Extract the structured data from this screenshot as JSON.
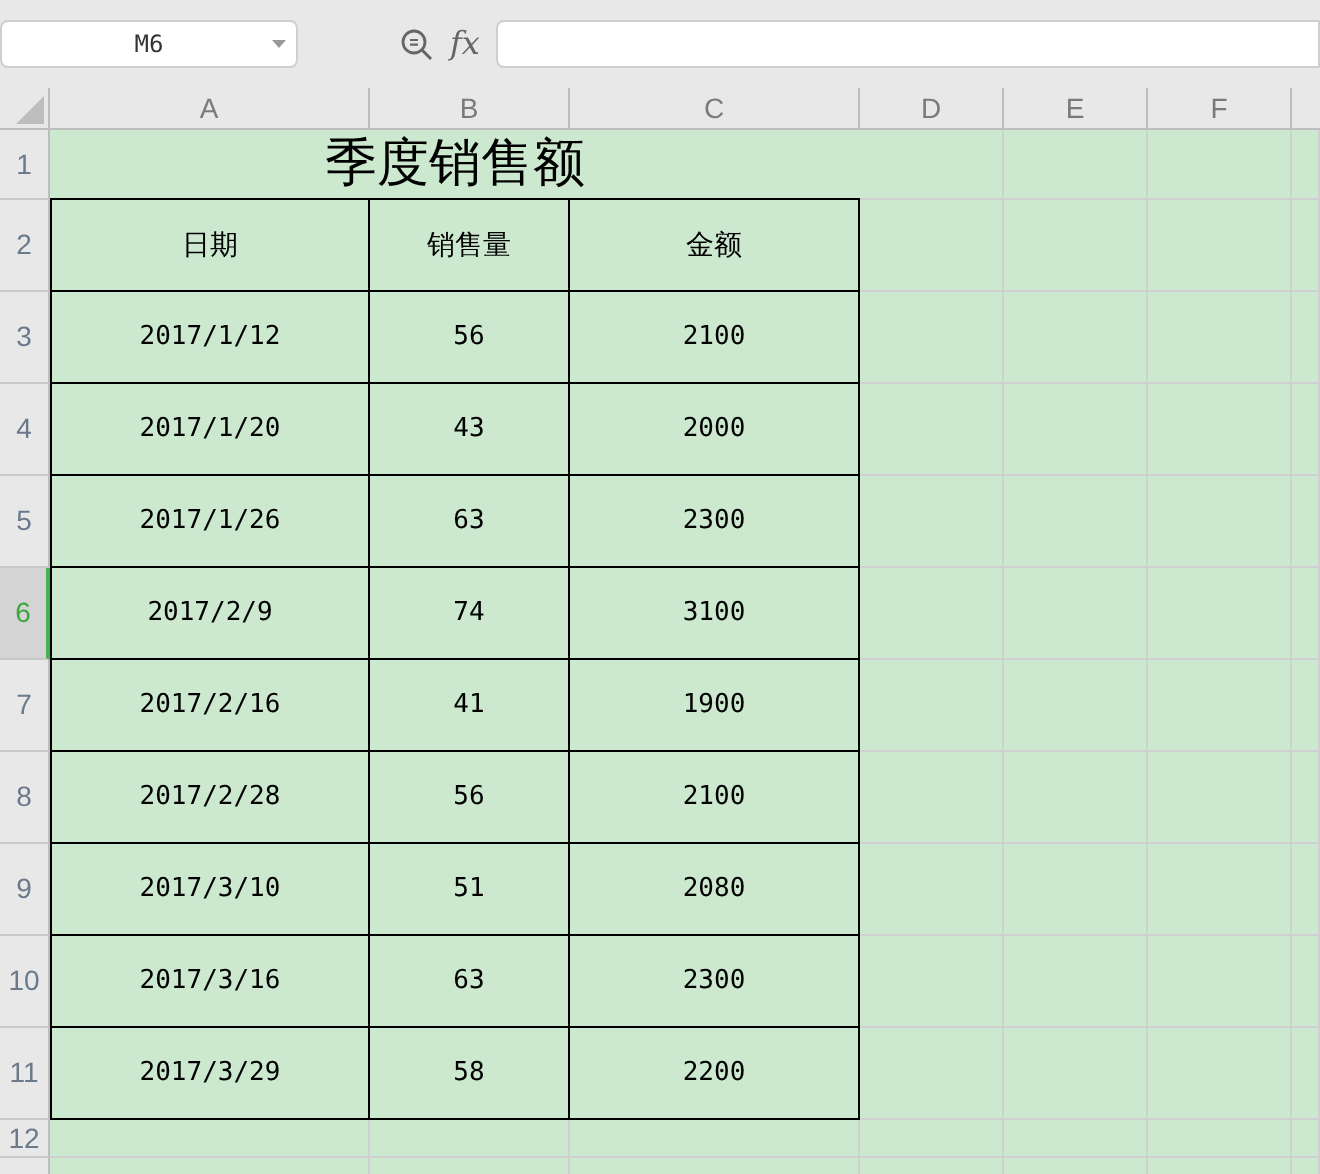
{
  "name_box": "M6",
  "formula_bar": {
    "fx": "fx"
  },
  "columns": [
    "A",
    "B",
    "C",
    "D",
    "E",
    "F"
  ],
  "title_row": {
    "number": "1",
    "selected": false,
    "title": "季度销售额"
  },
  "header_row": {
    "number": "2",
    "selected": false,
    "cells": [
      "日期",
      "销售量",
      "金额"
    ]
  },
  "rows": [
    {
      "number": "3",
      "selected": false,
      "cells": [
        "2017/1/12",
        "56",
        "2100"
      ]
    },
    {
      "number": "4",
      "selected": false,
      "cells": [
        "2017/1/20",
        "43",
        "2000"
      ]
    },
    {
      "number": "5",
      "selected": false,
      "cells": [
        "2017/1/26",
        "63",
        "2300"
      ]
    },
    {
      "number": "6",
      "selected": true,
      "cells": [
        "2017/2/9",
        "74",
        "3100"
      ]
    },
    {
      "number": "7",
      "selected": false,
      "cells": [
        "2017/2/16",
        "41",
        "1900"
      ]
    },
    {
      "number": "8",
      "selected": false,
      "cells": [
        "2017/2/28",
        "56",
        "2100"
      ]
    },
    {
      "number": "9",
      "selected": false,
      "cells": [
        "2017/3/10",
        "51",
        "2080"
      ]
    },
    {
      "number": "10",
      "selected": false,
      "cells": [
        "2017/3/16",
        "63",
        "2300"
      ]
    },
    {
      "number": "11",
      "selected": false,
      "cells": [
        "2017/3/29",
        "58",
        "2200"
      ]
    }
  ],
  "empty_rows": [
    {
      "number": "12",
      "selected": false
    }
  ]
}
